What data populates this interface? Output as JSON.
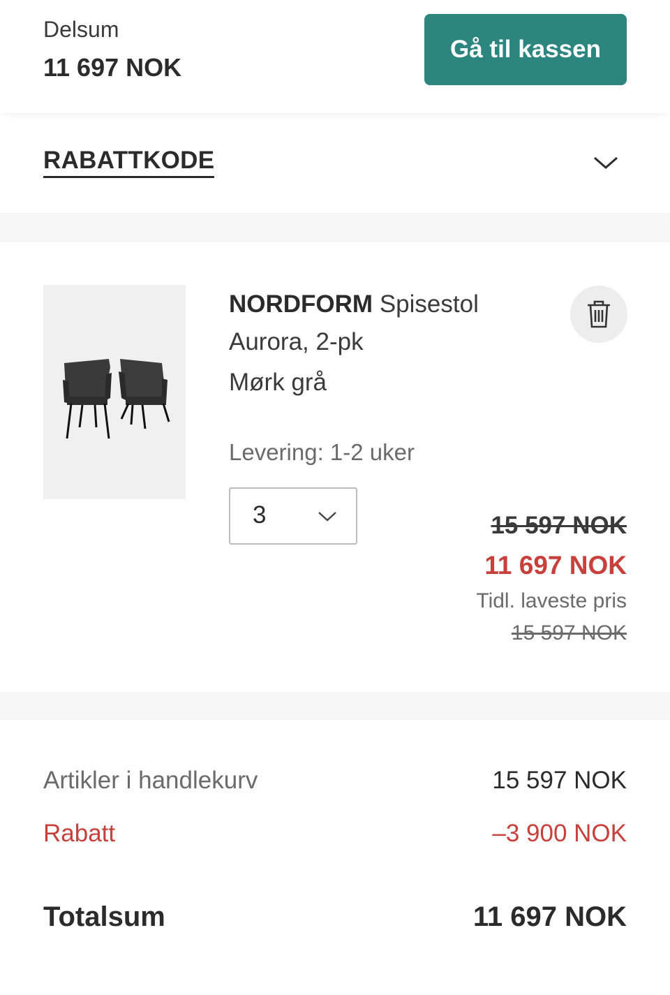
{
  "header": {
    "subtotal_label": "Delsum",
    "subtotal_value": "11 697 NOK",
    "checkout_label": "Gå til kassen"
  },
  "discount": {
    "title": "RABATTKODE"
  },
  "item": {
    "brand": "NORDFORM",
    "name": "Spisestol Aurora, 2-pk",
    "variant": "Mørk grå",
    "delivery": "Levering: 1-2 uker",
    "quantity": "3",
    "price_original": "15 597 NOK",
    "price_current": "11 697 NOK",
    "lowest_price_label": "Tidl. laveste pris",
    "lowest_price_value": "15 597 NOK"
  },
  "summary": {
    "items_label": "Artikler i handlekurv",
    "items_value": "15 597 NOK",
    "discount_label": "Rabatt",
    "discount_value": "–3 900 NOK",
    "total_label": "Totalsum",
    "total_value": "11 697 NOK"
  },
  "colors": {
    "accent": "#2d8580",
    "sale": "#c8403b"
  },
  "icons": {
    "delete": "trash-icon",
    "discount_toggle": "chevron-down-icon",
    "quantity": "chevron-down-icon"
  }
}
